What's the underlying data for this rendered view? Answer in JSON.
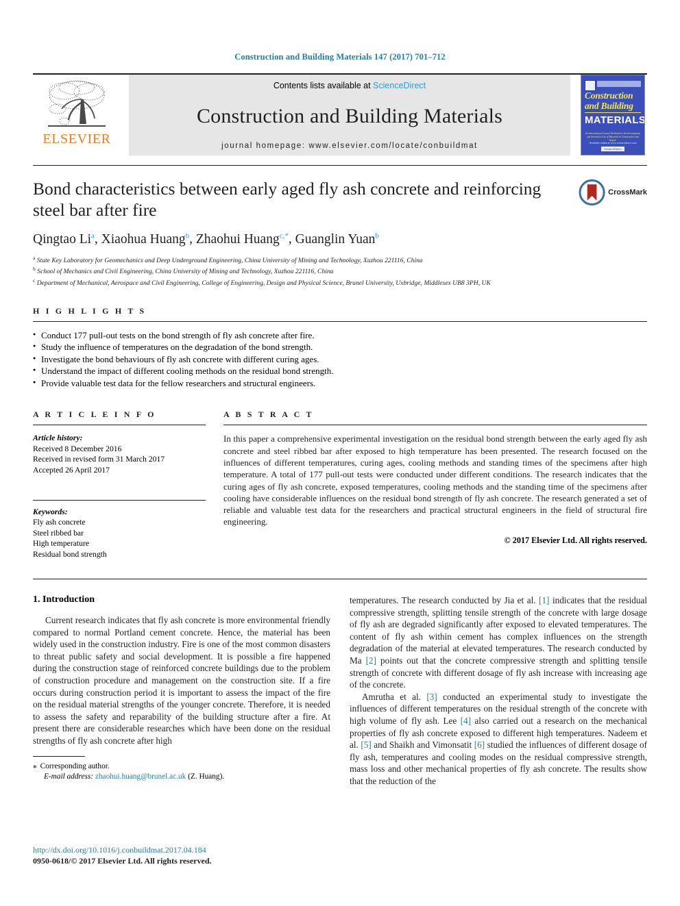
{
  "running_head": "Construction and Building Materials 147 (2017) 701–712",
  "masthead": {
    "publisher_logo_text": "ELSEVIER",
    "publisher_logo_icon": "elsevier-tree-icon",
    "contents_prefix": "Contents lists available at ",
    "contents_link": "ScienceDirect",
    "journal_title": "Construction and Building Materials",
    "homepage": "journal homepage: www.elsevier.com/locate/conbuildmat",
    "cover": {
      "line1": "Construction",
      "line2": "and Building",
      "line3": "MATERIALS",
      "blurb": "An International Journal Dedicated to the Investigation and Innovative Use of Materials in Construction and Repair",
      "foot": "Available online at www.sciencedirect.com",
      "foot_badge": "ScienceDirect"
    }
  },
  "article": {
    "title": "Bond characteristics between early aged fly ash concrete and reinforcing steel bar after fire",
    "crossmark_label": "CrossMark",
    "authors": [
      {
        "name": "Qingtao Li",
        "sup": "a",
        "sep": ", "
      },
      {
        "name": "Xiaohua Huang",
        "sup": "b",
        "sep": ", "
      },
      {
        "name": "Zhaohui Huang",
        "sup": "c,*",
        "sep": ", "
      },
      {
        "name": "Guanglin Yuan",
        "sup": "b",
        "sep": ""
      }
    ],
    "affiliations": [
      {
        "marker": "a",
        "text": "State Key Laboratory for Geomechanics and Deep Underground Engineering, China University of Mining and Technology, Xuzhou 221116, China"
      },
      {
        "marker": "b",
        "text": "School of Mechanics and Civil Engineering, China University of Mining and Technology, Xuzhou 221116, China"
      },
      {
        "marker": "c",
        "text": "Department of Mechanical, Aerospace and Civil Engineering, College of Engineering, Design and Physical Science, Brunel University, Uxbridge, Middlesex UB8 3PH, UK"
      }
    ]
  },
  "highlights": {
    "heading": "H I G H L I G H T S",
    "items": [
      "Conduct 177 pull-out tests on the bond strength of fly ash concrete after fire.",
      "Study the influence of temperatures on the degradation of the bond strength.",
      "Investigate the bond behaviours of fly ash concrete with different curing ages.",
      "Understand the impact of different cooling methods on the residual bond strength.",
      "Provide valuable test data for the fellow researchers and structural engineers."
    ]
  },
  "article_info": {
    "heading": "A R T I C L E    I N F O",
    "history_label": "Article history:",
    "history": [
      "Received 8 December 2016",
      "Received in revised form 31 March 2017",
      "Accepted 26 April 2017"
    ],
    "keywords_label": "Keywords:",
    "keywords": [
      "Fly ash concrete",
      "Steel ribbed bar",
      "High temperature",
      "Residual bond strength"
    ]
  },
  "abstract": {
    "heading": "A B S T R A C T",
    "text": "In this paper a comprehensive experimental investigation on the residual bond strength between the early aged fly ash concrete and steel ribbed bar after exposed to high temperature has been presented. The research focused on the influences of different temperatures, curing ages, cooling methods and standing times of the specimens after high temperature. A total of 177 pull-out tests were conducted under different conditions. The research indicates that the curing ages of fly ash concrete, exposed temperatures, cooling methods and the standing time of the specimens after cooling have considerable influences on the residual bond strength of fly ash concrete. The research generated a set of reliable and valuable test data for the researchers and practical structural engineers in the field of structural fire engineering.",
    "copyright": "© 2017 Elsevier Ltd. All rights reserved."
  },
  "body": {
    "section_heading": "1. Introduction",
    "left_para_1": "Current research indicates that fly ash concrete is more environmental friendly compared to normal Portland cement concrete. Hence, the material has been widely used in the construction industry. Fire is one of the most common disasters to threat public safety and social development. It is possible a fire happened during the construction stage of reinforced concrete buildings due to the problem of construction procedure and management on the construction site. If a fire occurs during construction period it is important to assess the impact of the fire on the residual material strengths of the younger concrete. Therefore, it is needed to assess the safety and reparability of the building structure after a fire. At present there are considerable researches which have been done on the residual strengths of fly ash concrete after high",
    "right_para_1_a": "temperatures. The research conducted by Jia et al. ",
    "right_ref_1": "[1]",
    "right_para_1_b": " indicates that the residual compressive strength, splitting tensile strength of the concrete with large dosage of fly ash are degraded significantly after exposed to elevated temperatures. The content of fly ash within cement has complex influences on the strength degradation of the material at elevated temperatures. The research conducted by Ma ",
    "right_ref_2": "[2]",
    "right_para_1_c": " points out that the concrete compressive strength and splitting tensile strength of concrete with different dosage of fly ash increase with increasing age of the concrete.",
    "right_para_2_a": "Amrutha et al. ",
    "right_ref_3": "[3]",
    "right_para_2_b": " conducted an experimental study to investigate the influences of different temperatures on the residual strength of the concrete with high volume of fly ash. Lee ",
    "right_ref_4": "[4]",
    "right_para_2_c": " also carried out a research on the mechanical properties of fly ash concrete exposed to different high temperatures. Nadeem et al. ",
    "right_ref_5": "[5]",
    "right_para_2_d": " and Shaikh and Vimonsatit ",
    "right_ref_6": "[6]",
    "right_para_2_e": " studied the influences of different dosage of fly ash, temperatures and cooling modes on the residual compressive strength, mass loss and other mechanical properties of fly ash concrete. The results show that the reduction of the"
  },
  "footer": {
    "corresponding_marker": "⁎",
    "corresponding_label": "Corresponding author.",
    "email_label": "E-mail address:",
    "email": "zhaohui.huang@brunel.ac.uk",
    "email_owner": "(Z. Huang).",
    "doi": "http://dx.doi.org/10.1016/j.conbuildmat.2017.04.184",
    "issn_line": "0950-0618/© 2017 Elsevier Ltd. All rights reserved."
  },
  "colors": {
    "link": "#1f7fa8",
    "sciencedirect": "#2b9cd8",
    "elsevier_orange": "#ef7d22",
    "band_gray": "#e6e6e6",
    "cover_blue": "#3a4fbb"
  }
}
